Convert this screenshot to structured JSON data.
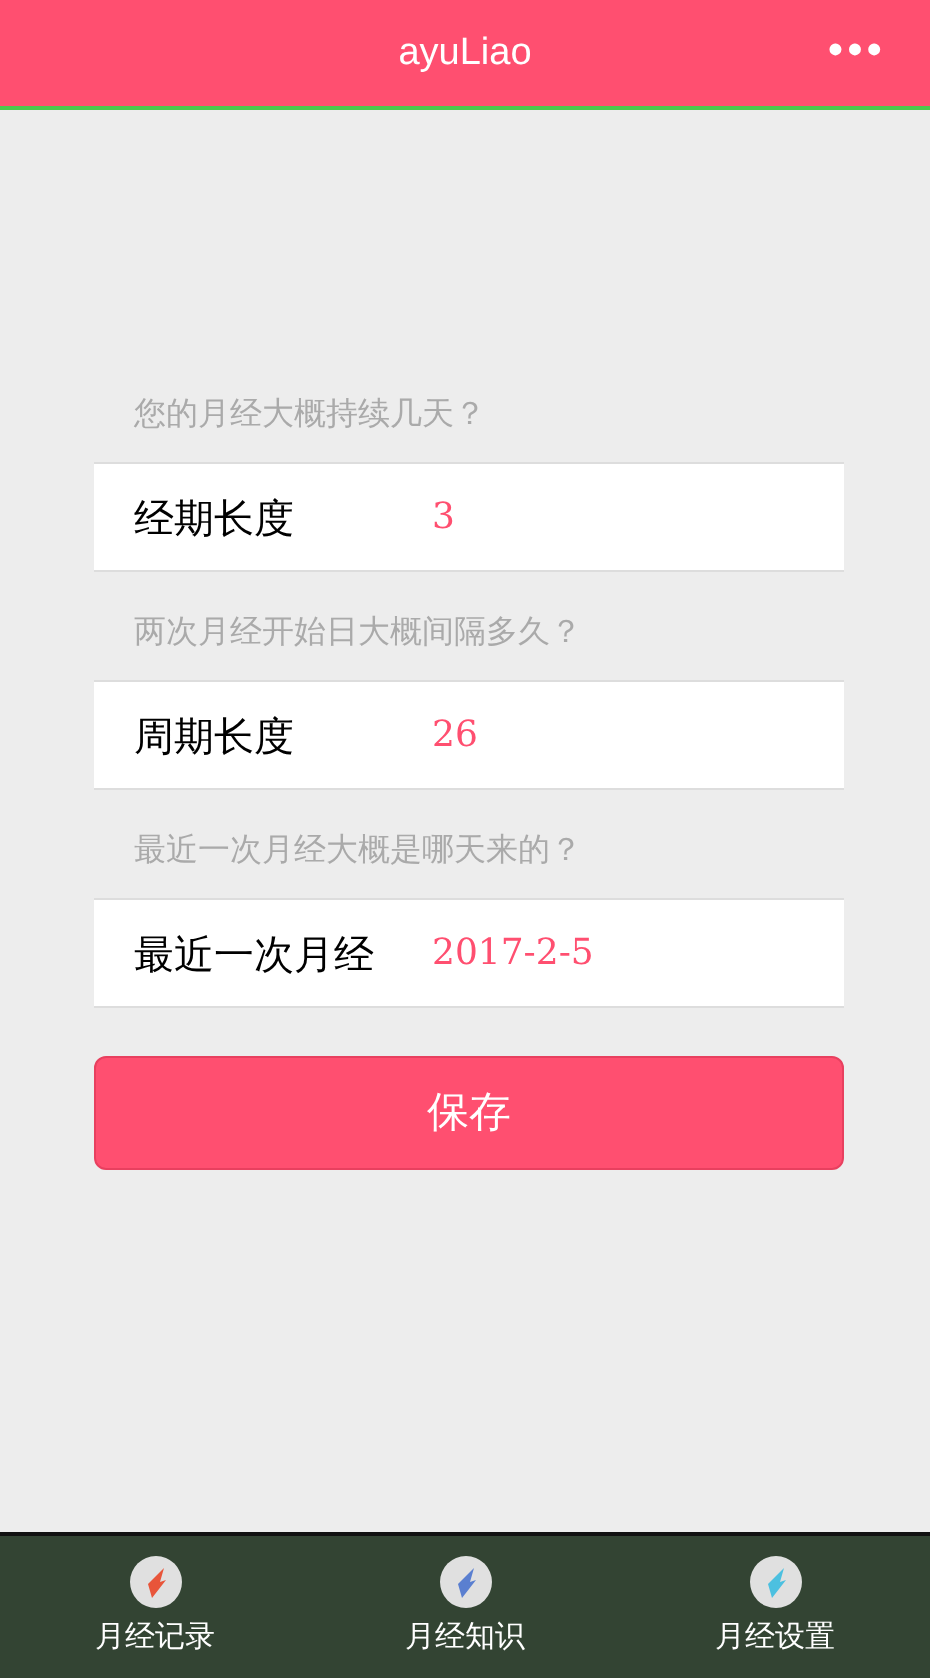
{
  "header": {
    "title": "ayuLiao",
    "menu": "•••"
  },
  "fields": [
    {
      "question": "您的月经大概持续几天？",
      "label": "经期长度",
      "value": "3"
    },
    {
      "question": "两次月经开始日大概间隔多久？",
      "label": "周期长度",
      "value": "26"
    },
    {
      "question": "最近一次月经大概是哪天来的？",
      "label": "最近一次月经",
      "value": "2017-2-5"
    }
  ],
  "save_button": "保存",
  "tab_bar": [
    {
      "label": "月经记录",
      "color": "#e8553a"
    },
    {
      "label": "月经知识",
      "color": "#5a7fd0"
    },
    {
      "label": "月经设置",
      "color": "#4cc0e0"
    }
  ]
}
